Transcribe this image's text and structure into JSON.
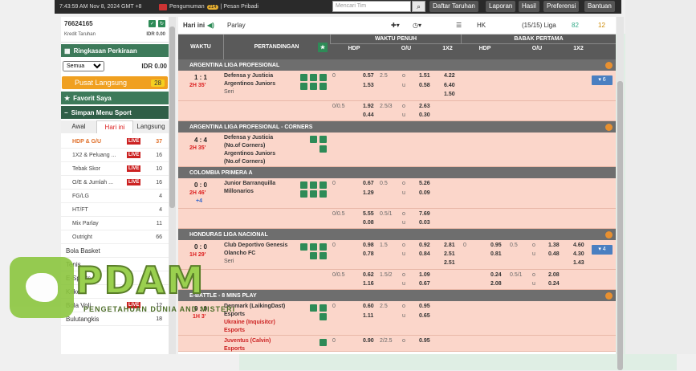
{
  "topbar": {
    "time": "7:43:59 AM Nov 8, 2024 GMT +8",
    "announcement": "Pengumuman",
    "announcement_count": "214",
    "message": "| Pesan Pribadi",
    "search_placeholder": "Mencari Tim",
    "nav": [
      "Daftar Taruhan",
      "Laporan",
      "Hasil",
      "Preferensi",
      "Bantuan"
    ]
  },
  "account": {
    "id": "76624165",
    "credit_label": "Kredit Taruhan",
    "credit_value": "IDR 0.00"
  },
  "sidebar": {
    "summary_title": "Ringkasan Perkiraan",
    "summary_select": "Semua",
    "summary_value": "IDR 0.00",
    "live_label": "Pusat Langsung",
    "live_count": "28",
    "fav_label": "Favorit Saya",
    "menu_title": "Simpan Menu Sport",
    "tabs": [
      "Awal",
      "Hari ini",
      "Langsung"
    ],
    "sports": [
      {
        "name": "Sepak Bola",
        "live": "LIVE",
        "count": "103"
      },
      {
        "name": "HDP & G/U",
        "live": "LIVE",
        "count": "37"
      },
      {
        "name": "1X2 & Peluang ...",
        "live": "LIVE",
        "count": "16"
      },
      {
        "name": "Tebak Skor",
        "live": "LIVE",
        "count": "10"
      },
      {
        "name": "O/E & Jumlah ...",
        "live": "LIVE",
        "count": "16"
      },
      {
        "name": "FG/LG",
        "live": "",
        "count": "4"
      },
      {
        "name": "HT/FT",
        "live": "",
        "count": "4"
      },
      {
        "name": "Mix Parlay",
        "live": "",
        "count": "11"
      },
      {
        "name": "Outright",
        "live": "",
        "count": "66"
      },
      {
        "name": "Bola Basket",
        "live": "",
        "count": ""
      },
      {
        "name": "Tenis",
        "live": "",
        "count": ""
      },
      {
        "name": "E-Sports",
        "live": "",
        "count": ""
      },
      {
        "name": "Kriket",
        "live": "",
        "count": ""
      },
      {
        "name": "Bola Voli",
        "live": "LIVE",
        "count": "12"
      },
      {
        "name": "Bulutangkis",
        "live": "",
        "count": "18"
      }
    ]
  },
  "subbar": {
    "today": "Hari ini",
    "parlay": "Parlay",
    "odds_type": "HK",
    "league_count": "(15/15) Liga",
    "count_a": "82",
    "count_b": "12"
  },
  "columns": {
    "waktu": "WAKTU",
    "pertandingan": "PERTANDINGAN",
    "full": "WAKTU PENUH",
    "half": "BABAK PERTAMA",
    "hdp": "HDP",
    "ou": "O/U",
    "x12": "1X2"
  },
  "leagues": [
    {
      "name": "ARGENTINA LIGA PROFESIONAL",
      "score": "1 : 1",
      "time": "2H 35'",
      "home": "Defensa y Justicia",
      "away": "Argentinos Juniors",
      "extra": "Seri",
      "l1": [
        "0",
        "0.57",
        "2.5",
        "o",
        "1.51",
        "4.22"
      ],
      "l2": [
        "1.53",
        "u",
        "0.58",
        "6.40"
      ],
      "l3": "1.50",
      "more": "6",
      "alt": [
        "0/0.5",
        "1.92",
        "2.5/3",
        "o",
        "2.63",
        "0.44",
        "u",
        "0.30"
      ]
    },
    {
      "name": "ARGENTINA LIGA PROFESIONAL - CORNERS",
      "score": "4 : 4",
      "time": "2H 35'",
      "home": "Defensa y Justicia",
      "home2": "(No.of Corners)",
      "away": "Argentinos Juniors",
      "away2": "(No.of Corners)"
    },
    {
      "name": "COLOMBIA PRIMERA A",
      "score": "0 : 0",
      "time": "2H 46'",
      "plus": "+4",
      "home": "Junior Barranquilla",
      "away": "Millonarios",
      "l1": [
        "0",
        "0.67",
        "0.5",
        "o",
        "5.26"
      ],
      "l2": [
        "1.29",
        "u",
        "0.09"
      ],
      "alt": [
        "0/0.5",
        "5.55",
        "0.5/1",
        "o",
        "7.69",
        "0.08",
        "u",
        "0.03"
      ]
    },
    {
      "name": "HONDURAS LIGA NACIONAL",
      "score": "0 : 0",
      "time": "1H 29'",
      "home": "Club Deportivo Genesis",
      "away": "Olancho FC",
      "extra": "Seri",
      "l1": [
        "0",
        "0.98",
        "1.5",
        "o",
        "0.92",
        "2.81",
        "0",
        "0.95",
        "0.5",
        "o",
        "1.38",
        "4.60"
      ],
      "l2": [
        "0.78",
        "u",
        "0.84",
        "2.51",
        "0.81",
        "u",
        "0.48",
        "4.30"
      ],
      "l3": [
        "2.51",
        "1.43"
      ],
      "more": "4",
      "alt": [
        "0/0.5",
        "0.62",
        "1.5/2",
        "o",
        "1.09",
        "0.24",
        "0.5/1",
        "o",
        "2.08",
        "1.16",
        "u",
        "0.67",
        "2.08",
        "u",
        "0.24"
      ]
    },
    {
      "name": "E-BATTLE - 8 MINS PLAY",
      "score": "0 : 0",
      "time": "1H 3'",
      "home": "Denmark (LaikingDast)",
      "home2": "Esports",
      "away": "Ukraine (Inquisitcr)",
      "away2": "Esports",
      "l1": [
        "0",
        "0.60",
        "2.5",
        "o",
        "0.95"
      ],
      "l2": [
        "1.11",
        "u",
        "0.65"
      ],
      "next_home": "Juventus (Calvin)",
      "next_home2": "Esports",
      "next": [
        "0",
        "0.90",
        "2/2.5",
        "o",
        "0.95"
      ]
    }
  ],
  "watermark": {
    "brand": "PDAM",
    "tagline": "PENGETAHUAN DUNIA AND MISTERI"
  }
}
